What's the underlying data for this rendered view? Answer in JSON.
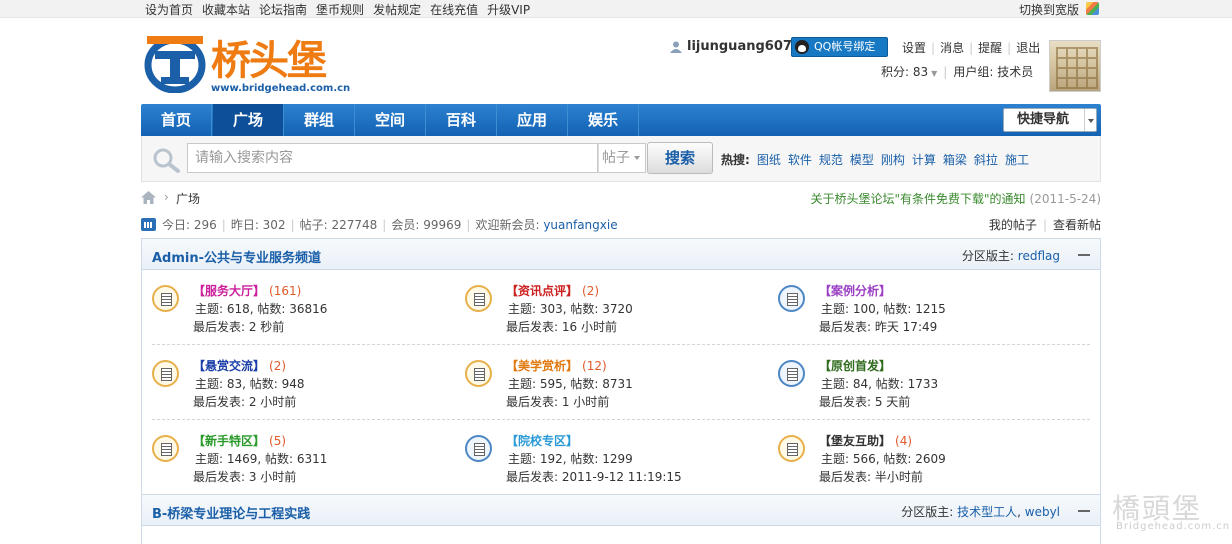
{
  "topbar": {
    "links": [
      "设为首页",
      "收藏本站",
      "论坛指南",
      "堡币规则",
      "发帖规定",
      "在线充值",
      "升级VIP"
    ],
    "wide_label": "切换到宽版"
  },
  "logo": {
    "name": "桥头堡",
    "url": "www.bridgehead.com.cn"
  },
  "user": {
    "username": "lijunguang607",
    "qq_button": "QQ帐号绑定",
    "links": [
      "设置",
      "消息",
      "提醒",
      "退出"
    ],
    "points": "积分: 83",
    "group": "用户组: 技术员"
  },
  "nav": {
    "items": [
      {
        "label": "首页",
        "active": false
      },
      {
        "label": "广场",
        "active": true
      },
      {
        "label": "群组",
        "active": false
      },
      {
        "label": "空间",
        "active": false
      },
      {
        "label": "百科",
        "active": false
      },
      {
        "label": "应用",
        "active": false
      },
      {
        "label": "娱乐",
        "active": false
      }
    ],
    "quick_nav": "快捷导航"
  },
  "search": {
    "placeholder": "请输入搜索内容",
    "type": "帖子",
    "button": "搜索",
    "hot_label": "热搜:",
    "hot_terms": [
      "图纸",
      "软件",
      "规范",
      "模型",
      "刚构",
      "计算",
      "箱梁",
      "斜拉",
      "施工"
    ]
  },
  "breadcrumb": {
    "current": "广场",
    "notice": "关于桥头堡论坛\"有条件免费下载\"的通知",
    "notice_date": "(2011-5-24)"
  },
  "stats": {
    "today": "今日: 296",
    "yesterday": "昨日: 302",
    "posts": "帖子: 227748",
    "members": "会员: 99969",
    "welcome": "欢迎新会员:",
    "new_member": "yuanfangxie",
    "my_posts": "我的帖子",
    "new_posts": "查看新帖"
  },
  "sections": [
    {
      "title": "Admin-公共与专业服务频道",
      "mods_label": "分区版主:",
      "mods": [
        "redflag"
      ],
      "forums": [
        {
          "name": "【服务大厅】",
          "color": "#cc1f9b",
          "count": "(161)",
          "stat": "主题: 618, 帖数: 36816",
          "last": "最后发表: 2 秒前",
          "icon": "yellow"
        },
        {
          "name": "【资讯点评】",
          "color": "#cc2020",
          "count": "(2)",
          "stat": "主题: 303, 帖数: 3720",
          "last": "最后发表: 16 小时前",
          "icon": "yellow"
        },
        {
          "name": "【案例分析】",
          "color": "#9a3fc4",
          "count": "",
          "stat": "主题: 100, 帖数: 1215",
          "last": "最后发表: 昨天 17:49",
          "icon": "blue"
        },
        {
          "name": "【悬赏交流】",
          "color": "#1b3fa8",
          "count": "(2)",
          "stat": "主题: 83, 帖数: 948",
          "last": "最后发表: 2 小时前",
          "icon": "yellow"
        },
        {
          "name": "【美学赏析】",
          "color": "#e07a10",
          "count": "(12)",
          "stat": "主题: 595, 帖数: 8731",
          "last": "最后发表: 1 小时前",
          "icon": "yellow"
        },
        {
          "name": "【原创首发】",
          "color": "#2f6b1c",
          "count": "",
          "stat": "主题: 84, 帖数: 1733",
          "last": "最后发表: 5 天前",
          "icon": "blue"
        },
        {
          "name": "【新手特区】",
          "color": "#2a9a2a",
          "count": "(5)",
          "stat": "主题: 1469, 帖数: 6311",
          "last": "最后发表: 3 小时前",
          "icon": "yellow"
        },
        {
          "name": "【院校专区】",
          "color": "#2a9ad6",
          "count": "",
          "stat": "主题: 192, 帖数: 1299",
          "last": "最后发表: 2011-9-12 11:19:15",
          "icon": "blue"
        },
        {
          "name": "【堡友互助】",
          "color": "#333333",
          "count": "(4)",
          "stat": "主题: 566, 帖数: 2609",
          "last": "最后发表: 半小时前",
          "icon": "yellow"
        }
      ]
    },
    {
      "title": "B-桥梁专业理论与工程实践",
      "mods_label": "分区版主:",
      "mods": [
        "技术型工人",
        "webyl"
      ]
    }
  ],
  "watermark": {
    "big": "橋頭堡",
    "small": "Bridgehead.com.cn"
  }
}
